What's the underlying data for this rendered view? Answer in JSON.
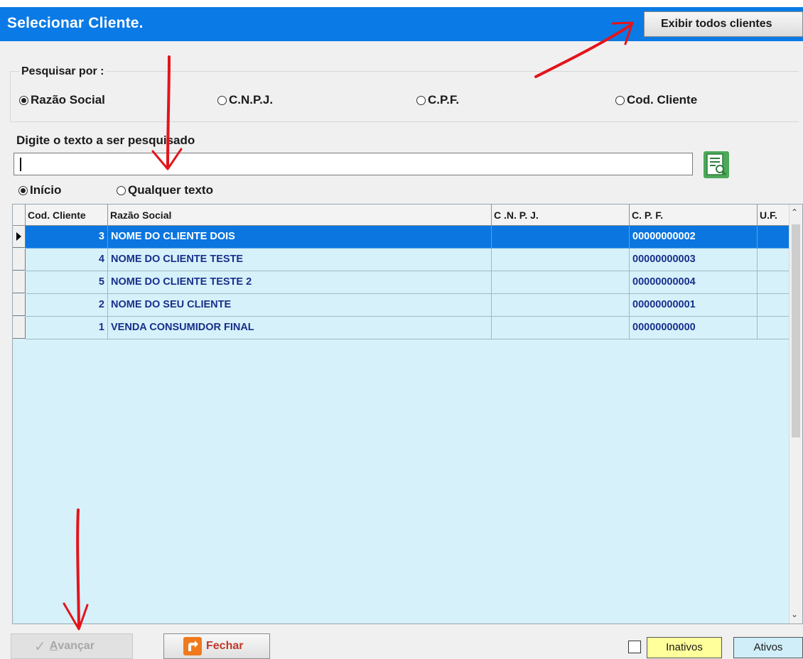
{
  "window": {
    "title": "Selecionar Cliente.",
    "show_all_label": "Exibir todos clientes"
  },
  "search_by": {
    "legend": "Pesquisar por :",
    "options": [
      {
        "label": "Razão Social",
        "selected": true
      },
      {
        "label": "C.N.P.J.",
        "selected": false
      },
      {
        "label": "C.P.F.",
        "selected": false
      },
      {
        "label": "Cod. Cliente",
        "selected": false
      }
    ]
  },
  "search": {
    "label": "Digite o texto a ser pesquisado",
    "value": "",
    "button_icon": "search-document-icon"
  },
  "match_mode": {
    "options": [
      {
        "label": "Início",
        "selected": true
      },
      {
        "label": "Qualquer texto",
        "selected": false
      }
    ]
  },
  "grid": {
    "columns": [
      "Cod. Cliente",
      "Razão Social",
      "C .N. P. J.",
      "C. P. F.",
      "U.F."
    ],
    "rows": [
      {
        "cod": "3",
        "razao": "NOME DO CLIENTE DOIS",
        "cnpj": "",
        "cpf": "00000000002",
        "uf": "",
        "selected": true
      },
      {
        "cod": "4",
        "razao": "NOME DO CLIENTE TESTE",
        "cnpj": "",
        "cpf": "00000000003",
        "uf": "",
        "selected": false
      },
      {
        "cod": "5",
        "razao": "NOME DO CLIENTE TESTE 2",
        "cnpj": "",
        "cpf": "00000000004",
        "uf": "",
        "selected": false
      },
      {
        "cod": "2",
        "razao": "NOME DO SEU CLIENTE",
        "cnpj": "",
        "cpf": "00000000001",
        "uf": "",
        "selected": false
      },
      {
        "cod": "1",
        "razao": "VENDA CONSUMIDOR FINAL",
        "cnpj": "",
        "cpf": "00000000000",
        "uf": "",
        "selected": false
      }
    ]
  },
  "footer": {
    "advance_label_prefix": "A",
    "advance_label_rest": "vançar",
    "close_label": "Fechar",
    "inactive_checked": false,
    "inactive_label": "Inativos",
    "active_label": "Ativos"
  },
  "colors": {
    "titlebar": "#0a7ae6",
    "grid_background": "#d7f1fb",
    "selected_row": "#0b76e0",
    "row_text": "#17308a",
    "annotation_arrows": "#e3141b",
    "inactive_badge": "#ffff9c"
  }
}
